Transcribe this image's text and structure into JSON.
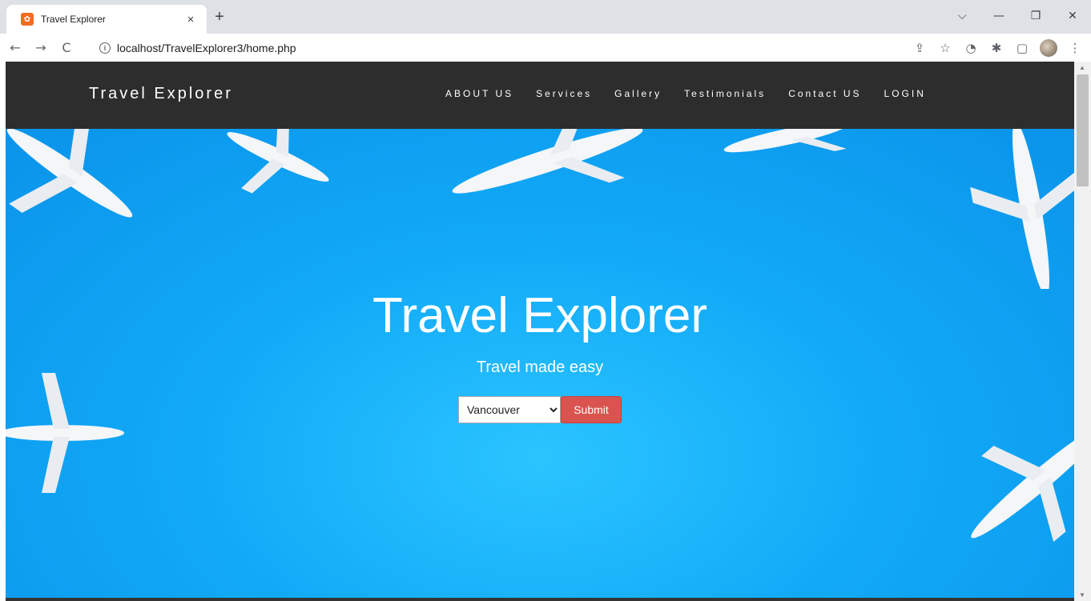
{
  "browser": {
    "tab_title": "Travel Explorer",
    "tab_close": "×",
    "new_tab": "+",
    "url": "localhost/TravelExplorer3/home.php",
    "window_controls": {
      "dropdown": "⌵",
      "minimize": "—",
      "restore": "❐",
      "close": "✕"
    },
    "nav": {
      "back": "←",
      "forward": "→",
      "reload": "C"
    },
    "toolbar_icons": {
      "share": "⇪",
      "bookmark": "☆",
      "extensions": "✱",
      "sidepanel": "▢",
      "menu": "⋮"
    }
  },
  "site": {
    "brand": "Travel Explorer",
    "menu": [
      "ABOUT US",
      "Services",
      "Gallery",
      "Testimonials",
      "Contact US",
      "LOGIN"
    ]
  },
  "hero": {
    "title": "Travel Explorer",
    "subtitle": "Travel made easy",
    "select_value": "Vancouver",
    "submit_label": "Submit"
  },
  "colors": {
    "nav_bg": "#2d2d2d",
    "hero_blue": "#12aaf7",
    "submit_red": "#d9534f"
  }
}
